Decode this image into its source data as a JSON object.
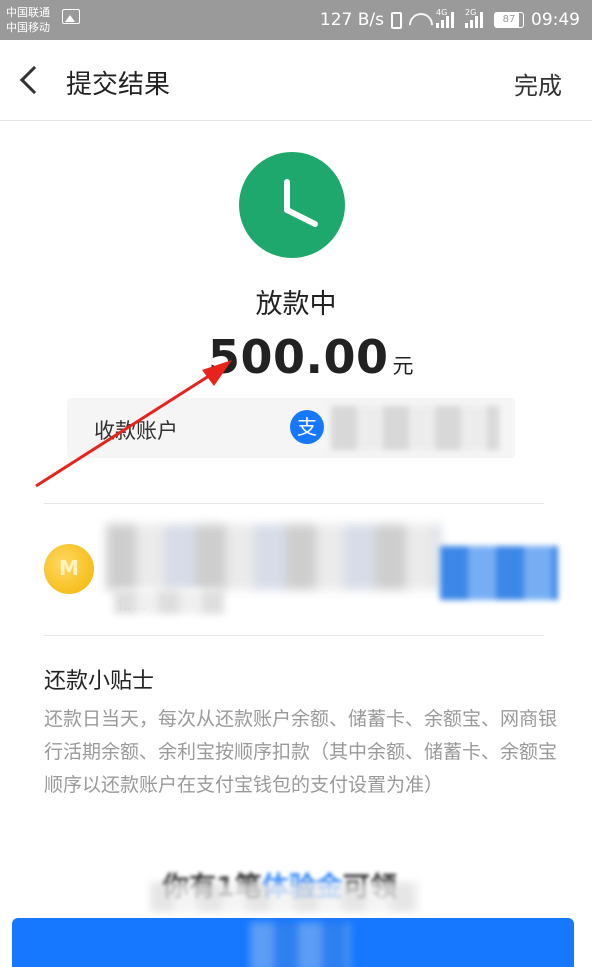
{
  "status_bar": {
    "carrier_1": "中国联通",
    "carrier_2": "中国移动",
    "network_speed": "127 B/s",
    "signal_1_tag": "4G",
    "signal_2_tag": "2G",
    "battery": "87",
    "time": "09:49"
  },
  "nav": {
    "title": "提交结果",
    "done_label": "完成"
  },
  "result": {
    "status": "放款中",
    "amount": "500.00",
    "unit": "元",
    "account_label": "收款账户",
    "alipay_glyph": "支"
  },
  "promo": {
    "subtitle": "借钱"
  },
  "tips": {
    "title": "还款小贴士",
    "body": "还款日当天，每次从还款账户余额、储蓄卡、余额宝、网商银行活期余额、余利宝按顺序扣款（其中余额、储蓄卡、余额宝顺序以还款账户在支付宝钱包的支付设置为准）"
  },
  "banner": {
    "prefix": "你有1笔",
    "highlight": "体验金",
    "suffix": "可领"
  },
  "colors": {
    "accent_green": "#1fa86d",
    "alipay_blue": "#1677ff",
    "arrow_red": "#e8231b"
  }
}
